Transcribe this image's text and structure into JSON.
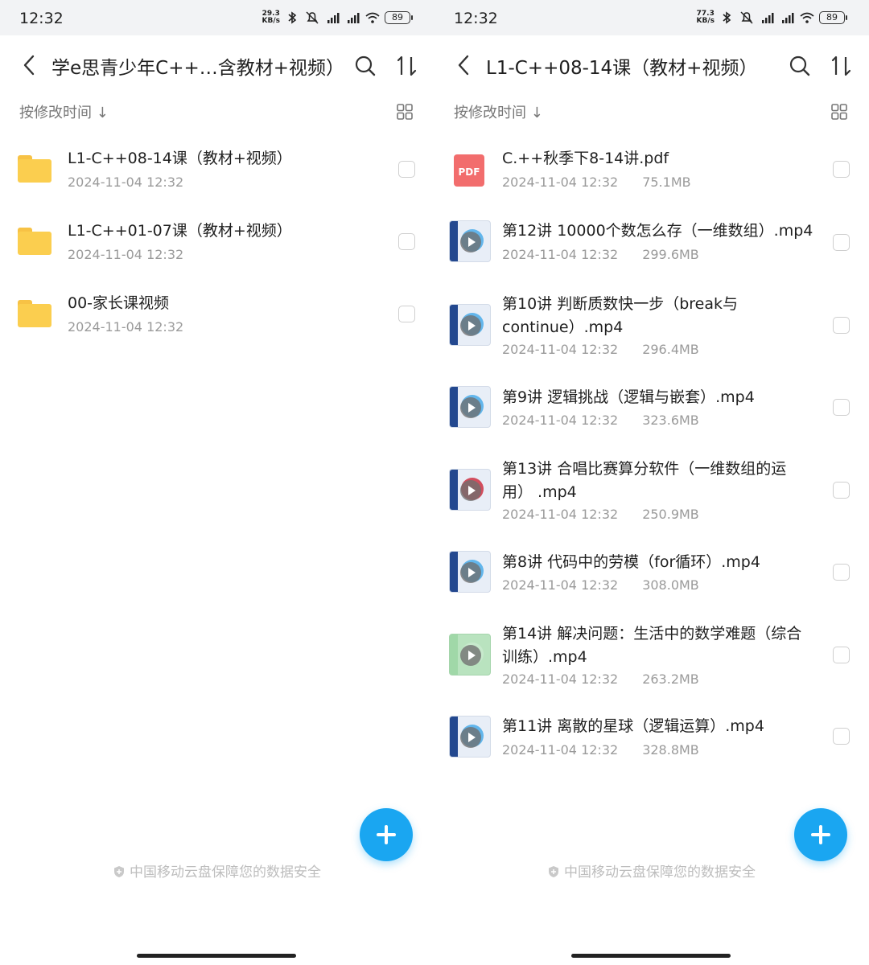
{
  "left": {
    "status": {
      "time": "12:32",
      "speed_value": "29.3",
      "speed_unit": "KB/s",
      "battery": "89"
    },
    "header": {
      "title": "学e思青少年C++…含教材+视频）"
    },
    "sort_label": "按修改时间 ↓",
    "items": [
      {
        "type": "folder",
        "name": "L1-C++08-14课（教材+视频）",
        "date": "2024-11-04 12:32"
      },
      {
        "type": "folder",
        "name": "L1-C++01-07课（教材+视频）",
        "date": "2024-11-04 12:32"
      },
      {
        "type": "folder",
        "name": "00-家长课视频",
        "date": "2024-11-04 12:32"
      }
    ],
    "footer": "中国移动云盘保障您的数据安全"
  },
  "right": {
    "status": {
      "time": "12:32",
      "speed_value": "77.3",
      "speed_unit": "KB/s",
      "battery": "89"
    },
    "header": {
      "title": "L1-C++08-14课（教材+视频）"
    },
    "sort_label": "按修改时间 ↓",
    "items": [
      {
        "type": "pdf",
        "thumb_label": "PDF",
        "name": "C.++秋季下8-14讲.pdf",
        "date": "2024-11-04 12:32",
        "size": "75.1MB"
      },
      {
        "type": "video",
        "name": "第12讲 10000个数怎么存（一维数组）.mp4",
        "date": "2024-11-04 12:32",
        "size": "299.6MB"
      },
      {
        "type": "video",
        "name": "第10讲 判断质数快一步（break与continue）.mp4",
        "date": "2024-11-04 12:32",
        "size": "296.4MB"
      },
      {
        "type": "video",
        "name": "第9讲 逻辑挑战（逻辑与嵌套）.mp4",
        "date": "2024-11-04 12:32",
        "size": "323.6MB"
      },
      {
        "type": "video-red",
        "name": "第13讲 合唱比赛算分软件（一维数组的运用） .mp4",
        "date": "2024-11-04 12:32",
        "size": "250.9MB"
      },
      {
        "type": "video",
        "name": "第8讲 代码中的劳模（for循环）.mp4",
        "date": "2024-11-04 12:32",
        "size": "308.0MB"
      },
      {
        "type": "video-green",
        "name": "第14讲 解决问题：生活中的数学难题（综合训练）.mp4",
        "date": "2024-11-04 12:32",
        "size": "263.2MB"
      },
      {
        "type": "video",
        "name": "第11讲 离散的星球（逻辑运算）.mp4",
        "date": "2024-11-04 12:32",
        "size": "328.8MB"
      }
    ],
    "footer": "中国移动云盘保障您的数据安全"
  },
  "colors": {
    "accent": "#1aa6f1",
    "folder": "#fbce4f",
    "pdf": "#f26d6d"
  },
  "icons": [
    "back-icon",
    "search-icon",
    "sort-icon",
    "grid-view-icon",
    "shield-icon",
    "add-icon",
    "folder-icon",
    "pdf-icon",
    "video-thumb-icon"
  ]
}
